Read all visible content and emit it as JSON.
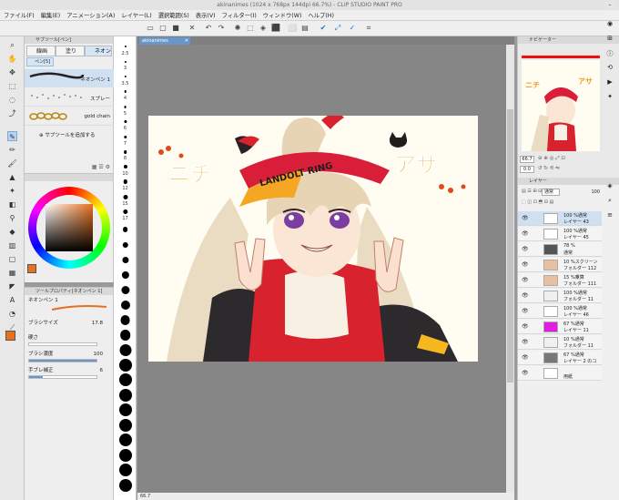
{
  "window": {
    "title": "akinanimes (1024 x 768px 144dpi 66.7%) - CLIP STUDIO PAINT PRO"
  },
  "menu": [
    "ファイル(F)",
    "編集(E)",
    "アニメーション(A)",
    "レイヤー(L)",
    "選択範囲(S)",
    "表示(V)",
    "フィルター(I)",
    "ウィンドウ(W)",
    "ヘルプ(H)"
  ],
  "subtool": {
    "title": "サブツール[ペン]",
    "groups": [
      "線画",
      "塗り",
      "ネオン"
    ],
    "selected_group": "ネオン",
    "tab": "ペン[5]",
    "brushes": [
      "ネオンペン 1",
      "スプレー",
      "gold chain"
    ],
    "add_label": "サブツールを追加する"
  },
  "tool_property": {
    "title": "ツールプロパティ[ネオンペン 1]",
    "name": "ネオンペン 1",
    "brush_size_label": "ブラシサイズ",
    "brush_size_value": "17.8",
    "hardness_label": "硬さ",
    "opacity_label": "ブラシ濃度",
    "opacity_value": "100",
    "stabilization_label": "手ブレ補正",
    "stabilization_value": "6"
  },
  "size_palette": [
    "2.5",
    "3",
    "3.5",
    "4",
    "5",
    "6",
    "7",
    "8",
    "10",
    "12",
    "15",
    "17",
    "20",
    "25",
    "30",
    "40",
    "50",
    "60",
    "70",
    "80",
    "100",
    "120",
    "150",
    "170",
    "200",
    "250",
    "300",
    "400",
    "500",
    "600"
  ],
  "document": {
    "tab": "akinanimes"
  },
  "artwork": {
    "text_left": "ニチ",
    "text_right": "アサ",
    "visor_text": "LANDOLT RING"
  },
  "status": {
    "zoom": "66.7"
  },
  "navigator": {
    "title": "ナビゲーター",
    "zoom": "66.7",
    "angle": "0.0"
  },
  "layers": {
    "title": "レイヤー",
    "blend_mode": "通常",
    "opacity": "100",
    "items": [
      {
        "l1": "100 %通常",
        "l2": "レイヤー 43"
      },
      {
        "l1": "100 %通常",
        "l2": "レイヤー 45"
      },
      {
        "l1": "78 %",
        "l2": "通常"
      },
      {
        "l1": "10 %スクリーン",
        "l2": "フォルダー 112"
      },
      {
        "l1": "15 %乗算",
        "l2": "フォルダー 111"
      },
      {
        "l1": "100 %通常",
        "l2": "フォルダー 11"
      },
      {
        "l1": "100 %通常",
        "l2": "レイヤー 46"
      },
      {
        "l1": "67 %通常",
        "l2": "レイヤー 11"
      },
      {
        "l1": "10 %通常",
        "l2": "フォルダー 11"
      },
      {
        "l1": "67 %通常",
        "l2": "レイヤー 2 のコ"
      },
      {
        "l1": "",
        "l2": "用紙"
      }
    ]
  },
  "colors": {
    "accent": "#e8711f",
    "selection": "#cfe0f3",
    "visor_orange": "#f5a623",
    "visor_red": "#d91e3a"
  }
}
